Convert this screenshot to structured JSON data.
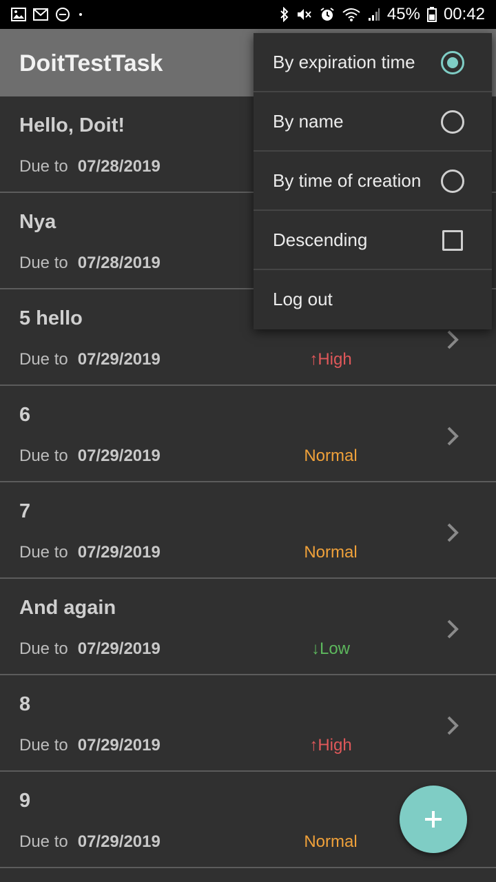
{
  "status_bar": {
    "battery": "45%",
    "time": "00:42",
    "left_icons": [
      "gallery-icon",
      "gmail-icon",
      "dnd-icon",
      "dot-icon"
    ],
    "right_icons": [
      "bluetooth-icon",
      "mute-icon",
      "alarm-icon",
      "wifi-icon",
      "signal-icon",
      "battery-icon"
    ]
  },
  "app_bar": {
    "title": "DoitTestTask"
  },
  "tasks": [
    {
      "title": "Hello, Doit!",
      "due_label": "Due to",
      "date": "07/28/2019",
      "priority": ""
    },
    {
      "title": "Nya",
      "due_label": "Due to",
      "date": "07/28/2019",
      "priority": ""
    },
    {
      "title": "5 hello",
      "due_label": "Due to",
      "date": "07/29/2019",
      "priority": "↑High"
    },
    {
      "title": "6",
      "due_label": "Due to",
      "date": "07/29/2019",
      "priority": "Normal"
    },
    {
      "title": "7",
      "due_label": "Due to",
      "date": "07/29/2019",
      "priority": "Normal"
    },
    {
      "title": "And again",
      "due_label": "Due to",
      "date": "07/29/2019",
      "priority": "↓Low"
    },
    {
      "title": "8",
      "due_label": "Due to",
      "date": "07/29/2019",
      "priority": "↑High"
    },
    {
      "title": "9",
      "due_label": "Due to",
      "date": "07/29/2019",
      "priority": "Normal"
    }
  ],
  "menu": {
    "items": [
      {
        "label": "By expiration time",
        "control": "radio",
        "checked": true
      },
      {
        "label": "By name",
        "control": "radio",
        "checked": false
      },
      {
        "label": "By time of creation",
        "control": "radio",
        "checked": false
      },
      {
        "label": "Descending",
        "control": "checkbox",
        "checked": false
      },
      {
        "label": "Log out",
        "control": "none",
        "checked": false
      }
    ]
  },
  "fab": {
    "icon": "plus-icon"
  },
  "colors": {
    "accent": "#7fcdc5",
    "high": "#e0585a",
    "normal": "#f0a13a",
    "low": "#5db85d",
    "background": "#303030",
    "app_bar": "#6e6e6e"
  }
}
